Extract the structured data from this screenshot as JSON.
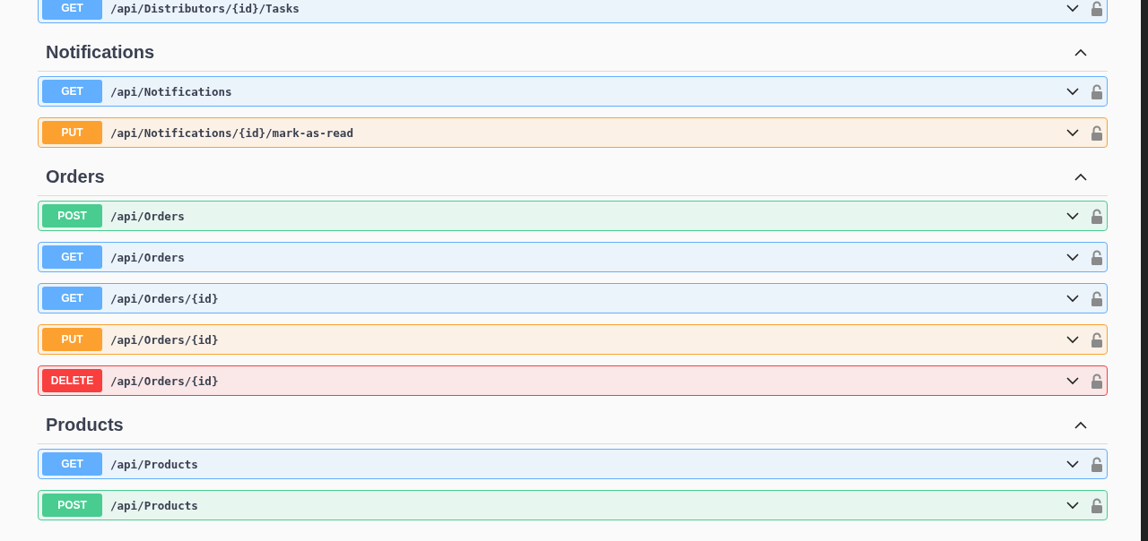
{
  "sections": [
    {
      "operations": [
        {
          "method": "GET",
          "path": "/api/Distributors/{id}/Tasks",
          "expanded": false
        }
      ]
    },
    {
      "title": "Notifications",
      "expanded": true,
      "operations": [
        {
          "method": "GET",
          "path": "/api/Notifications",
          "expanded": false
        },
        {
          "method": "PUT",
          "path": "/api/Notifications/{id}/mark-as-read",
          "expanded": false
        }
      ]
    },
    {
      "title": "Orders",
      "expanded": true,
      "operations": [
        {
          "method": "POST",
          "path": "/api/Orders",
          "expanded": false
        },
        {
          "method": "GET",
          "path": "/api/Orders",
          "expanded": false
        },
        {
          "method": "GET",
          "path": "/api/Orders/{id}",
          "expanded": false
        },
        {
          "method": "PUT",
          "path": "/api/Orders/{id}",
          "expanded": false
        },
        {
          "method": "DELETE",
          "path": "/api/Orders/{id}",
          "expanded": false
        }
      ]
    },
    {
      "title": "Products",
      "expanded": true,
      "operations": [
        {
          "method": "GET",
          "path": "/api/Products",
          "expanded": false
        },
        {
          "method": "POST",
          "path": "/api/Products",
          "expanded": false
        }
      ]
    }
  ]
}
